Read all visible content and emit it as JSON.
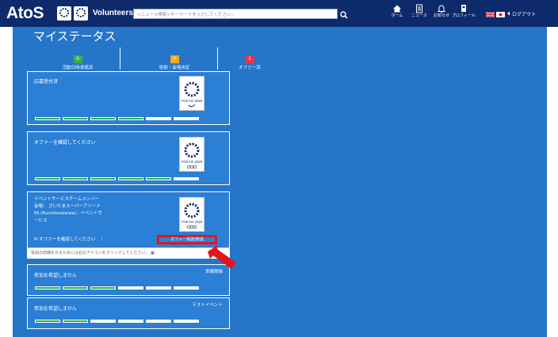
{
  "header": {
    "brand": "AtoS",
    "site_name": "Volunteers",
    "search_placeholder": "<ニュース検索>キーワードを入力してください。",
    "nav": [
      {
        "label": "ホーム",
        "icon": "home-icon"
      },
      {
        "label": "ニュース",
        "icon": "news-icon"
      },
      {
        "label": "お知らせ",
        "icon": "bell-icon"
      },
      {
        "label": "プロフィール",
        "icon": "profile-icon"
      }
    ],
    "logout_label": "ログアウト",
    "colors": {
      "bar": "#0d2a6b"
    }
  },
  "page": {
    "title": "マイステータス",
    "background": "#2575c9",
    "stats": [
      {
        "count": "0",
        "label": "活動日時承諾済",
        "color": "#2db24a"
      },
      {
        "count": "0",
        "label": "役割・会場決定",
        "color": "#f0a81e"
      },
      {
        "count": "1",
        "label": "オファー済",
        "color": "#e8344e"
      }
    ]
  },
  "cards": [
    {
      "title": "応募受付済",
      "progress": {
        "filled": 4,
        "total": 6
      }
    },
    {
      "title": "オファーを確認してください",
      "progress": {
        "filled": 5,
        "total": 6
      }
    },
    {
      "lines": [
        "イベントサービスチームメンバー",
        "会場： さいたまスーパーアリーナ",
        "FA (Functionalarea) : イベントサ",
        "ービス"
      ],
      "status": "オファーを確認してください　｜",
      "button": "オファー承諾/辞退",
      "note": "役割の詳細をみるためには右のアイコンをクリックしてください。"
    },
    {
      "title": "参加を希望しません",
      "right_label": "準備期間",
      "progress": {
        "filled": 3,
        "total": 6
      }
    },
    {
      "title": "参加を希望しません",
      "right_label": "テストイベント",
      "progress": {
        "filled": 2,
        "total": 6
      }
    }
  ],
  "logo": {
    "lines": [
      "TOKYO 2020"
    ]
  },
  "colors": {
    "progress_fill": "#2db24a",
    "progress_empty": "#ffffff",
    "highlight": "#e4151c"
  }
}
